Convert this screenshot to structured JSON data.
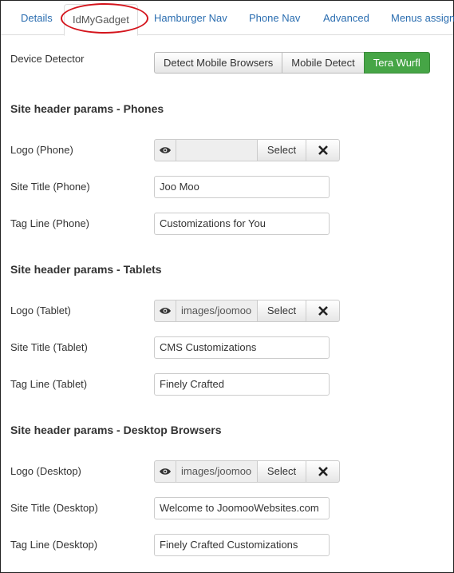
{
  "tabs": [
    {
      "label": "Details"
    },
    {
      "label": "IdMyGadget",
      "active": true
    },
    {
      "label": "Hamburger Nav"
    },
    {
      "label": "Phone Nav"
    },
    {
      "label": "Advanced"
    },
    {
      "label": "Menus assign"
    }
  ],
  "device_detector": {
    "label": "Device Detector",
    "options": [
      "Detect Mobile Browsers",
      "Mobile Detect",
      "Tera Wurfl"
    ],
    "selected": "Tera Wurfl"
  },
  "phones": {
    "heading": "Site header params - Phones",
    "logo_label": "Logo (Phone)",
    "logo_value": "",
    "title_label": "Site Title (Phone)",
    "title_value": "Joo Moo",
    "tagline_label": "Tag Line (Phone)",
    "tagline_value": "Customizations for You"
  },
  "tablets": {
    "heading": "Site header params - Tablets",
    "logo_label": "Logo (Tablet)",
    "logo_value": "images/joomoo",
    "title_label": "Site Title (Tablet)",
    "title_value": "CMS Customizations",
    "tagline_label": "Tag Line (Tablet)",
    "tagline_value": "Finely Crafted"
  },
  "desktop": {
    "heading": "Site header params - Desktop Browsers",
    "logo_label": "Logo (Desktop)",
    "logo_value": "images/joomoo",
    "title_label": "Site Title (Desktop)",
    "title_value": "Welcome to JoomooWebsites.com",
    "tagline_label": "Tag Line (Desktop)",
    "tagline_value": "Finely Crafted Customizations"
  },
  "media_select_label": "Select",
  "colors": {
    "link": "#2a6db0",
    "active_button": "#46a546",
    "highlight_circle": "#d4141c"
  }
}
